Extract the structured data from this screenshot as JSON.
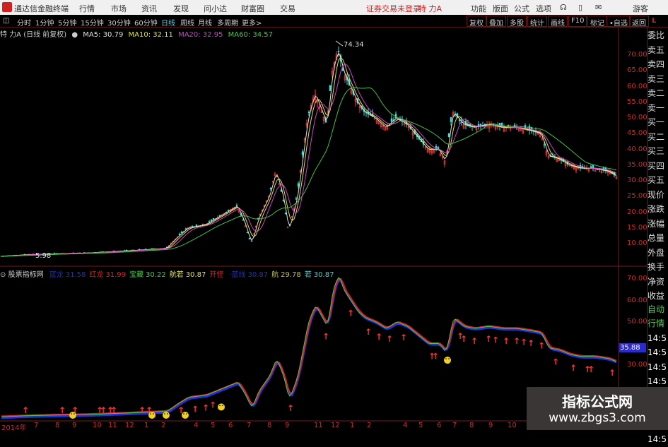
{
  "titlebar": {
    "app": "通达信金融终端",
    "menu": [
      "行情",
      "市场",
      "资讯",
      "发现",
      "问小达",
      "财富圈",
      "交易"
    ],
    "login_status": "证券交易未登录",
    "stock": "特 力A",
    "right_menu": [
      "功能",
      "版面",
      "公式",
      "选项"
    ],
    "user": "游客"
  },
  "toolbar": {
    "periods": [
      "分时",
      "1分钟",
      "5分钟",
      "15分钟",
      "30分钟",
      "60分钟",
      "日线",
      "周线",
      "月线",
      "多周期",
      "更多>"
    ],
    "active": "日线",
    "buttons": [
      "复权",
      "叠加",
      "多股",
      "统计",
      "画线",
      "F10",
      "标记",
      "•自选",
      "返回"
    ]
  },
  "infobar": {
    "title": "特 力A (日线 前复权)",
    "ma": [
      {
        "label": "MA5: 30.79",
        "color": "#e0e0e0"
      },
      {
        "label": "MA10: 32.11",
        "color": "#e0e040"
      },
      {
        "label": "MA20: 32.95",
        "color": "#d040d0"
      },
      {
        "label": "MA60: 34.57",
        "color": "#40d040"
      }
    ]
  },
  "indicator": {
    "name": "股票指标网",
    "items": [
      {
        "label": "蓝龙",
        "value": "31.58",
        "color": "#2030c0"
      },
      {
        "label": "红龙",
        "value": "31.99",
        "color": "#e02020"
      },
      {
        "label": "宝藏",
        "value": "30.22",
        "color": "#40d040"
      },
      {
        "label": "航若",
        "value": "30.87",
        "color": "#e0e040"
      },
      {
        "label": "开怪",
        "value": "",
        "color": "#e02020"
      },
      {
        "label": "·蓝线",
        "value": "30.87",
        "color": "#2030c0"
      },
      {
        "label": "航",
        "value": "29.78",
        "color": "#c0c040"
      },
      {
        "label": "若",
        "value": "30.87",
        "color": "#40d0d0"
      }
    ]
  },
  "price_axis": [
    "70.00",
    "65.00",
    "60.00",
    "55.00",
    "50.00",
    "45.00",
    "40.00",
    "35.00",
    "30.00",
    "25.00",
    "20.00",
    "15.00",
    "10.00"
  ],
  "ind_axis": [
    "70.00",
    "60.00",
    "50.00",
    "30.00"
  ],
  "ind_current": "35.88",
  "annotations": {
    "high": "74.34",
    "low": "5.98"
  },
  "dates": [
    "2014年",
    "7",
    "8",
    "9",
    "10",
    "11",
    "12",
    "1",
    "2",
    "4",
    "5",
    "6",
    "7",
    "8",
    "9",
    "11",
    "12",
    "1",
    "2",
    "4",
    "5",
    "6",
    "7",
    "8",
    "9",
    "10"
  ],
  "panel": {
    "quote": [
      "委比",
      "卖五",
      "卖四",
      "卖三",
      "卖二",
      "卖一",
      "买一",
      "买二",
      "买三",
      "买四",
      "买五",
      "现价",
      "涨跌",
      "涨幅",
      "总量",
      "外盘",
      "换手",
      "净资",
      "收益"
    ],
    "lower": [
      "自动",
      "行情",
      "14:5",
      "14:5",
      "14:5",
      "14:5",
      "14:5",
      "14:5",
      "14:5",
      "14:5"
    ]
  },
  "watermark": {
    "title": "指标公式网",
    "url": "www.zbgs3.com"
  },
  "chart_data": {
    "type": "candlestick",
    "ylim": [
      5,
      75
    ],
    "series": [
      {
        "values": [
          6,
          6.5,
          6.8,
          7,
          7.5,
          8,
          8.5,
          12,
          15,
          16,
          20,
          22,
          17,
          10,
          18,
          25,
          33,
          25,
          14,
          25,
          50,
          58,
          52,
          48,
          65,
          72,
          65,
          60,
          55,
          52,
          50,
          47,
          50,
          48,
          44,
          40,
          40,
          36,
          52,
          48,
          47,
          48,
          47,
          47,
          46,
          45,
          38,
          37,
          35,
          34,
          34,
          33,
          31
        ]
      }
    ]
  }
}
